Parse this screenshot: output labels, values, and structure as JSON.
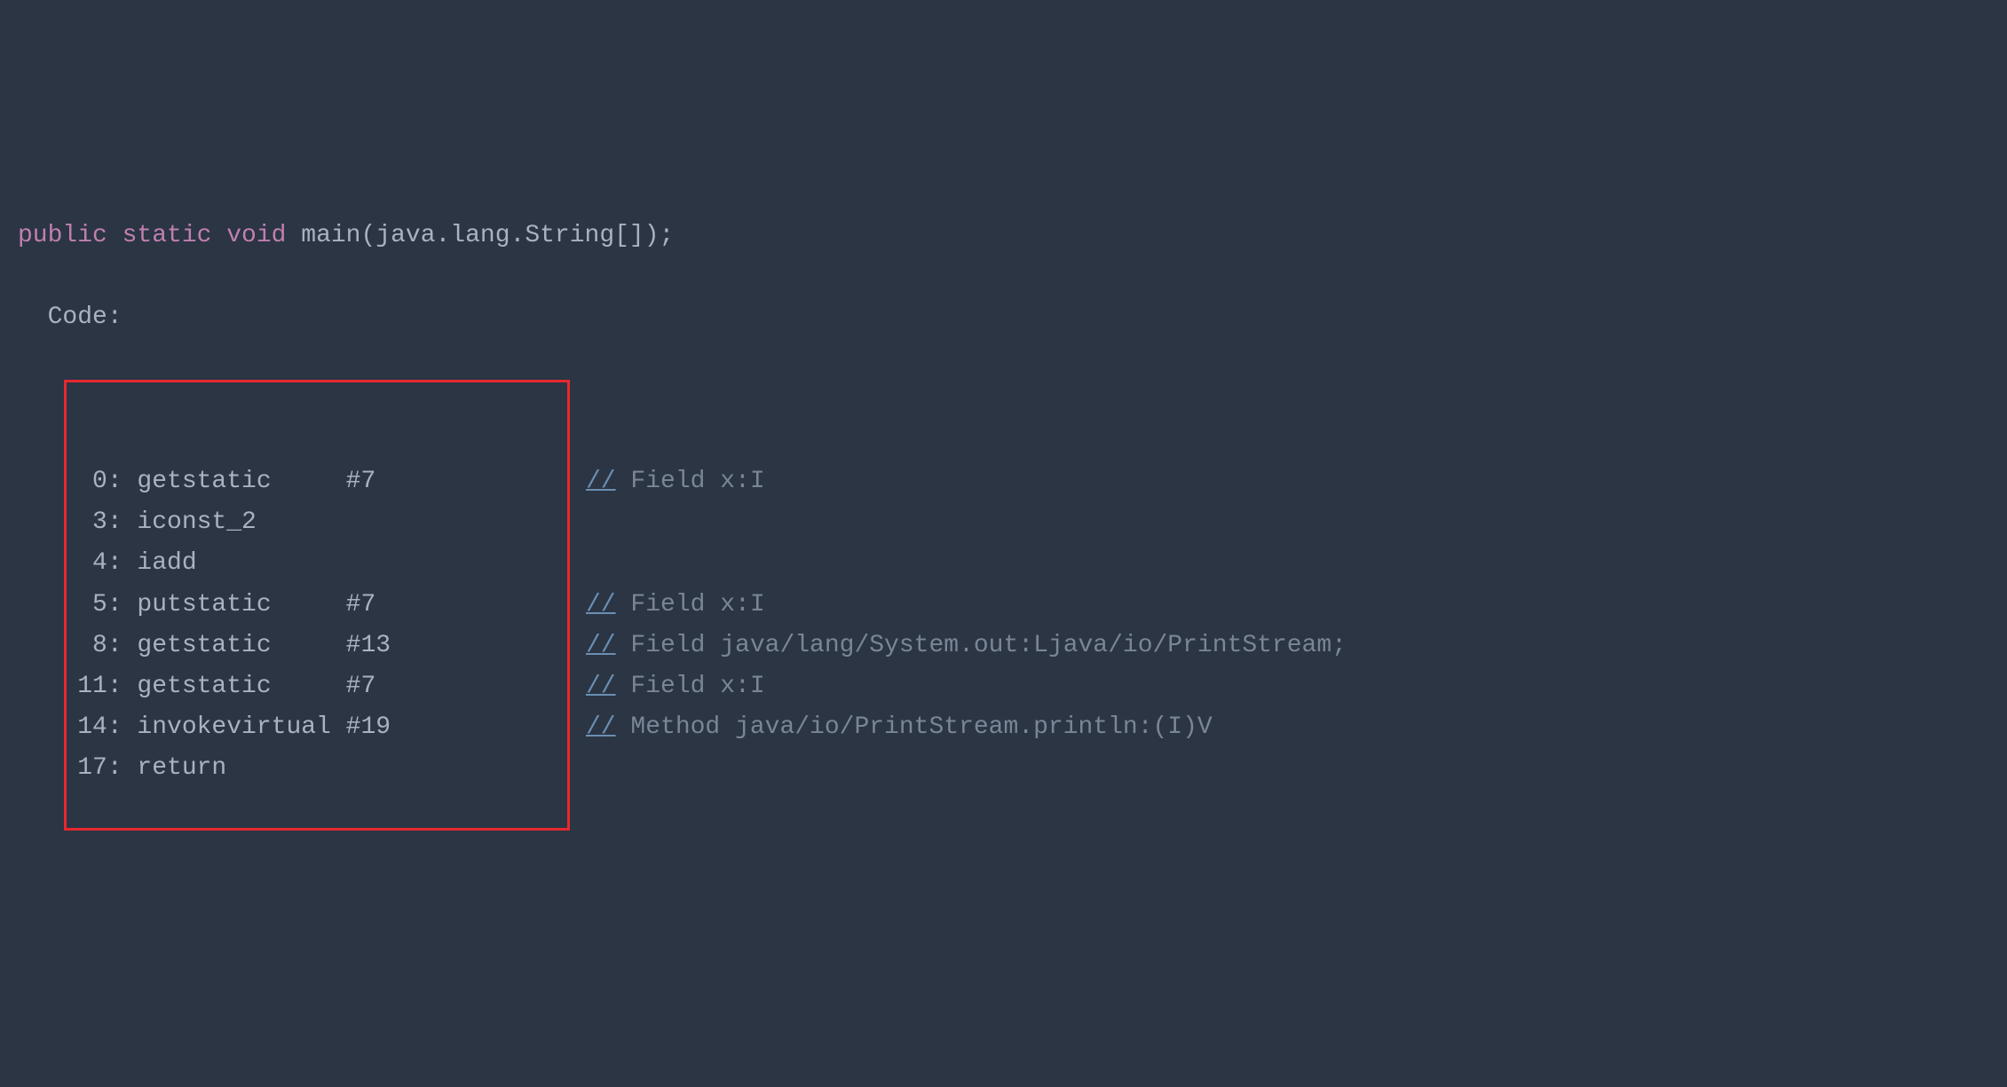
{
  "signature": {
    "modifiers": "public static void",
    "name": "main",
    "params": "(java.lang.String[]);"
  },
  "code_label": "Code:",
  "instructions": [
    {
      "index": "0",
      "op": "getstatic",
      "arg": "#7",
      "comment": "Field x:I"
    },
    {
      "index": "3",
      "op": "iconst_2",
      "arg": "",
      "comment": ""
    },
    {
      "index": "4",
      "op": "iadd",
      "arg": "",
      "comment": ""
    },
    {
      "index": "5",
      "op": "putstatic",
      "arg": "#7",
      "comment": "Field x:I"
    },
    {
      "index": "8",
      "op": "getstatic",
      "arg": "#13",
      "comment": "Field java/lang/System.out:Ljava/io/PrintStream;"
    },
    {
      "index": "11",
      "op": "getstatic",
      "arg": "#7",
      "comment": "Field x:I"
    },
    {
      "index": "14",
      "op": "invokevirtual",
      "arg": "#19",
      "comment": "Method java/io/PrintStream.println:(I)V"
    },
    {
      "index": "17",
      "op": "return",
      "arg": "",
      "comment": ""
    }
  ]
}
